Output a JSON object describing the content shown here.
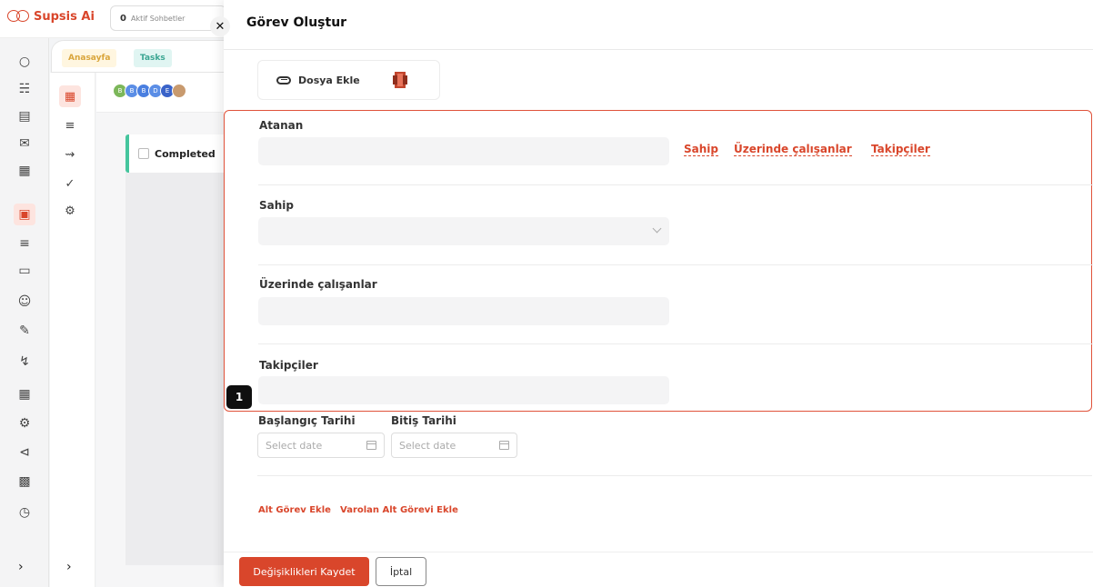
{
  "app": {
    "brand": "Supsis Ai",
    "active_chats_count": "0",
    "active_chats_label": "Aktif Sohbetler"
  },
  "tabs": [
    {
      "label": "Anasayfa"
    },
    {
      "label": "Tasks"
    }
  ],
  "board": {
    "avatars": [
      "B",
      "B",
      "B",
      "D",
      "E"
    ],
    "column_title": "Completed"
  },
  "drawer": {
    "title": "Görev Oluştur",
    "attach_label": "Dosya Ekle",
    "fields": {
      "assignee_label": "Atanan",
      "owner_label": "Sahip",
      "workers_label": "Üzerinde çalışanlar",
      "followers_label": "Takipçiler"
    },
    "role_links": [
      "Sahip",
      "Üzerinde çalışanlar",
      "Takipçiler"
    ],
    "start_date_label": "Başlangıç Tarihi",
    "end_date_label": "Bitiş Tarihi",
    "date_placeholder": "Select date",
    "add_subtask": "Alt Görev Ekle",
    "add_existing_subtask": "Varolan Alt Görevi Ekle",
    "save_button": "Değişiklikleri Kaydet",
    "cancel_button": "İptal"
  },
  "highlight_badge": "1",
  "colors": {
    "accent": "#d9462b",
    "highlight_border": "#e0523a",
    "completed_stripe": "#45c59d"
  }
}
